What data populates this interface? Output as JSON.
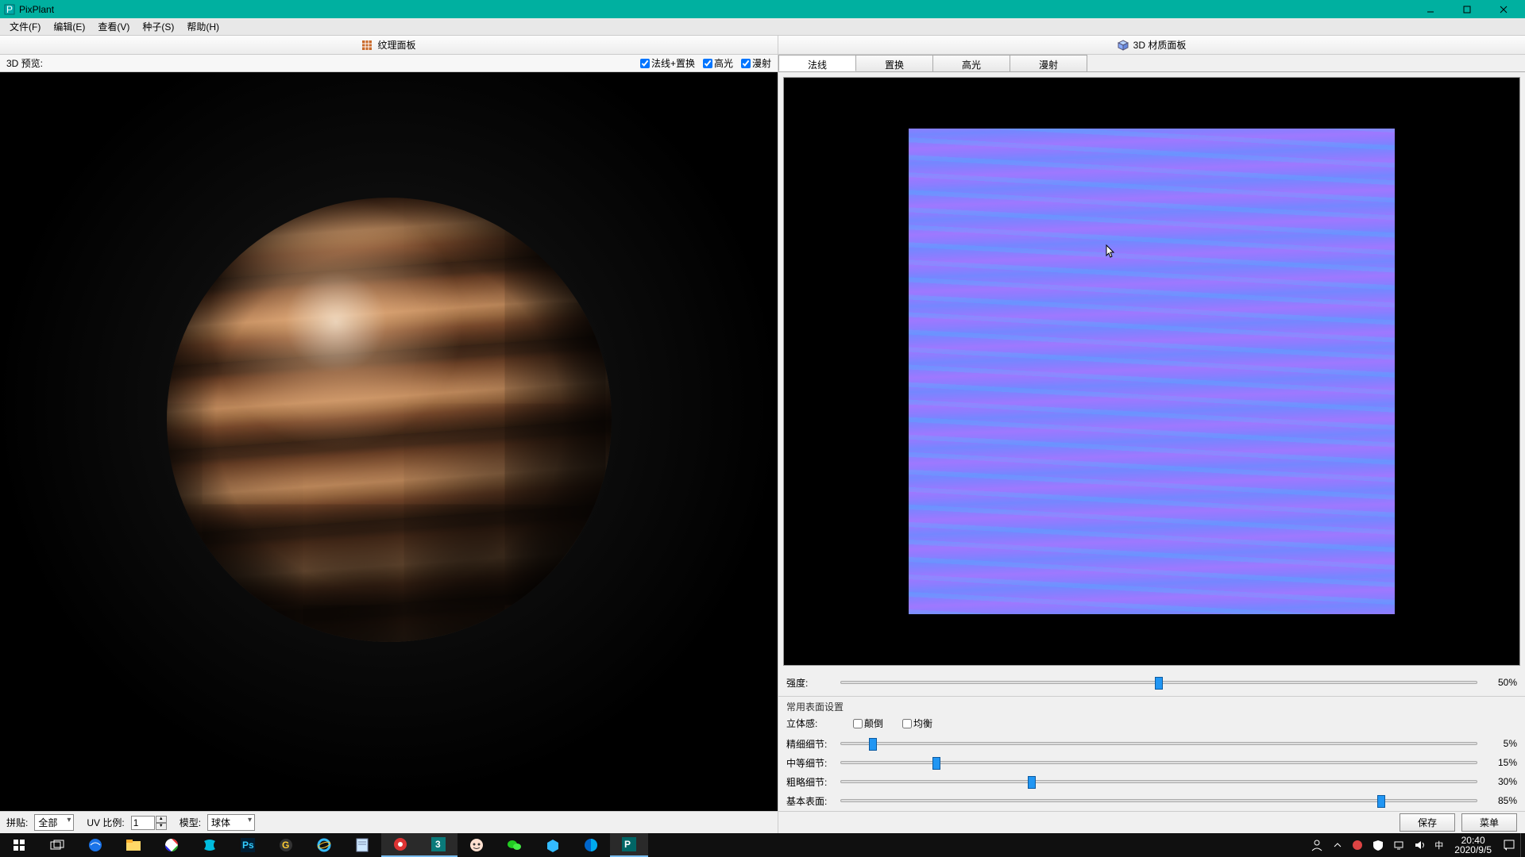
{
  "app": {
    "title": "PixPlant"
  },
  "menus": [
    "文件(F)",
    "编辑(E)",
    "查看(V)",
    "种子(S)",
    "帮助(H)"
  ],
  "leftPanel": {
    "title": "纹理面板",
    "previewLabel": "3D 预览:",
    "checks": [
      {
        "label": "法线+置换",
        "checked": true
      },
      {
        "label": "高光",
        "checked": true
      },
      {
        "label": "漫射",
        "checked": true
      }
    ],
    "bottom": {
      "tileLabel": "拼贴:",
      "tileValue": "全部",
      "uvLabel": "UV 比例:",
      "uvValue": "1",
      "modelLabel": "模型:",
      "modelValue": "球体"
    }
  },
  "rightPanel": {
    "title": "3D 材质面板",
    "tabs": [
      "法线",
      "置换",
      "高光",
      "漫射"
    ],
    "activeTab": 0,
    "intensity": {
      "label": "强度:",
      "value": "50%",
      "pct": 50
    },
    "surfaceSection": "常用表面设置",
    "stereo": {
      "label": "立体感:",
      "flip": "颠倒",
      "balance": "均衡"
    },
    "sliders": [
      {
        "label": "精细细节:",
        "value": "5%",
        "pct": 5
      },
      {
        "label": "中等细节:",
        "value": "15%",
        "pct": 15
      },
      {
        "label": "粗略细节:",
        "value": "30%",
        "pct": 30
      },
      {
        "label": "基本表面:",
        "value": "85%",
        "pct": 85
      }
    ],
    "buttons": {
      "save": "保存",
      "menu": "菜单"
    }
  },
  "taskbar": {
    "ime": "中",
    "time": "20:40",
    "date": "2020/9/5"
  }
}
